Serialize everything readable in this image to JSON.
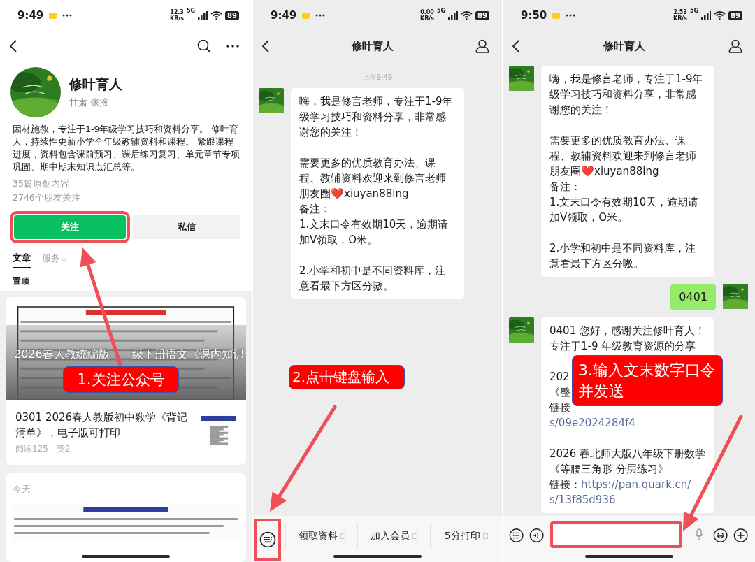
{
  "profile_screen": {
    "status_bar": {
      "time": "9:49",
      "speed": "12.3",
      "unit": "KB/s",
      "network": "5G",
      "battery": "89"
    },
    "name": "修叶育人",
    "location": "甘肃 张掖",
    "description": "因材施教，专注于1-9年级学习技巧和资料分享。 修叶育人，持续性更新小学全年级教辅资料和课程。 紧跟课程进度，资料包含课前预习、课后练习复习、单元章节专项巩固、期中期末知识点汇总等。",
    "stats": [
      "35篇原创内容",
      "2746个朋友关注"
    ],
    "buttons": [
      {
        "kind": "follow",
        "label": "关注",
        "highlighted": true
      },
      {
        "kind": "message",
        "label": "私信",
        "highlighted": false
      }
    ],
    "tabs": [
      {
        "label": "文章",
        "selected": true
      },
      {
        "label": "服务",
        "selected": false
      }
    ],
    "section_label": "置顶",
    "pinned_article": {
      "overlay_title_parts": [
        "2026春人教统编版",
        "级下册语文《课内知识"
      ],
      "title": "0301 2026春人教版初中数学《背记清单》，电子版可打印",
      "reads": "阅读125",
      "likes": "赞2"
    },
    "recent": {
      "date_label": "今天"
    },
    "callout": "1.关注公众号"
  },
  "chat_menu_screen": {
    "status_bar": {
      "time": "9:49",
      "speed": "0.00",
      "unit": "KB/s",
      "network": "5G",
      "battery": "89"
    },
    "title": "修叶育人",
    "timestamp": "上午9:49",
    "messages": [
      {
        "kind": "received",
        "blocks": [
          {
            "kind": "text",
            "text": "嗨，我是修言老师，专注于1-9年级学习技巧和资料分享，非常感谢您的关注！"
          },
          {
            "kind": "text",
            "text": "需要更多的优质教育办法、课程、教辅资料欢迎来到修言老师朋友圈❤️xiuyan88ing\n备注：\n1.文末口令有效期10天，逾期请加V领取，O米。"
          },
          {
            "kind": "text",
            "text": "2.小学和初中是不同资料库，注意看最下方区分嗷。"
          }
        ]
      }
    ],
    "menu": {
      "keyboard_highlighted": true,
      "items": [
        "领取资料",
        "加入会员",
        "5分打印"
      ]
    },
    "callout": "2.点击键盘输入"
  },
  "chat_input_screen": {
    "status_bar": {
      "time": "9:50",
      "speed": "2.53",
      "unit": "KB/s",
      "network": "5G",
      "battery": "89"
    },
    "title": "修叶育人",
    "messages": [
      {
        "kind": "received",
        "blocks": [
          {
            "kind": "text",
            "text": "嗨，我是修言老师，专注于1-9年级学习技巧和资料分享，非常感谢您的关注！"
          },
          {
            "kind": "text",
            "text": "需要更多的优质教育办法、课程、教辅资料欢迎来到修言老师朋友圈❤️xiuyan88ing\n备注：\n1.文末口令有效期10天，逾期请加V领取，O米。"
          },
          {
            "kind": "text",
            "text": "2.小学和初中是不同资料库，注意看最下方区分嗷。"
          }
        ]
      },
      {
        "kind": "sent",
        "blocks": [
          {
            "kind": "text",
            "text": "0401"
          }
        ]
      },
      {
        "kind": "received",
        "blocks": [
          {
            "kind": "lines",
            "lines": [
              "0401 您好，感谢关注修叶育人！",
              "专注于1-9 年级教育资源的分享"
            ]
          },
          {
            "kind": "lines",
            "lines": [
              "202",
              "《整",
              "链接"
            ]
          },
          {
            "kind": "link",
            "text": "s/09e2024284f4"
          },
          {
            "kind": "lines",
            "lines": [
              "2026 春北师大版八年级下册数学",
              "《等腰三角形 分层练习》"
            ]
          },
          {
            "kind": "link_line",
            "label": "链接：",
            "text": "https://pan.quark.cn/"
          },
          {
            "kind": "link",
            "text": "s/13f85d936"
          }
        ]
      }
    ],
    "input": {
      "highlighted": true
    },
    "callout": "3.输入文末数字口令并发送"
  }
}
